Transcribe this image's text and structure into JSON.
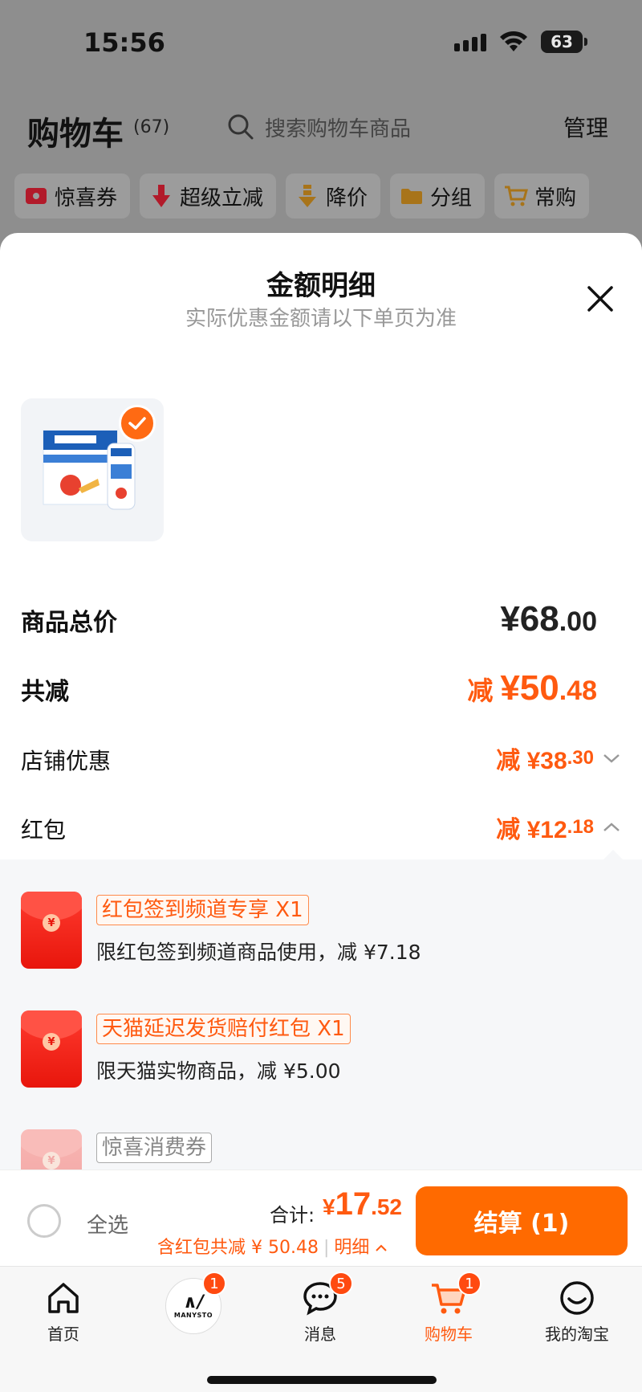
{
  "status_bar": {
    "time": "15:56",
    "battery": "63"
  },
  "cart_header": {
    "title": "购物车",
    "count": "(67)",
    "search_placeholder": "搜索购物车商品",
    "manage": "管理"
  },
  "chips": [
    {
      "label": "惊喜券",
      "icon": "coupon-icon"
    },
    {
      "label": "超级立减",
      "icon": "down-arrow-icon"
    },
    {
      "label": "降价",
      "icon": "price-drop-icon"
    },
    {
      "label": "分组",
      "icon": "folder-icon"
    },
    {
      "label": "常购",
      "icon": "cart-icon"
    }
  ],
  "sheet": {
    "title": "金额明细",
    "subtitle": "实际优惠金额请以下单页为准",
    "product": {
      "selected": true
    },
    "rows": {
      "total_label": "商品总价",
      "total_int": "¥68",
      "total_dec": ".00",
      "reduce_label": "共减",
      "reduce_prefix": "减 ",
      "reduce_int": "¥50",
      "reduce_dec": ".48",
      "shop_label": "店铺优惠",
      "shop_value_int": "减 ¥38",
      "shop_value_dec": ".30",
      "hongbao_label": "红包",
      "hongbao_value_int": "减 ¥12",
      "hongbao_value_dec": ".18"
    },
    "hongbao_items": [
      {
        "tag": "红包签到频道专享 X1",
        "desc": "限红包签到频道商品使用，减 ¥7.18",
        "faded": false
      },
      {
        "tag": "天猫延迟发货赔付红包 X1",
        "desc": "限天猫实物商品，减 ¥5.00",
        "faded": false
      },
      {
        "tag": "惊喜消费券",
        "desc": "",
        "faded": true
      }
    ]
  },
  "checkout": {
    "select_all": "全选",
    "total_label": "合计:",
    "total_prefix": "¥",
    "total_int": "17",
    "total_dec": ".52",
    "note": "含红包共减 ¥ 50.48",
    "detail": "明细",
    "button": "结算 (1)"
  },
  "tabs": [
    {
      "label": "首页",
      "icon": "home-icon",
      "badge": ""
    },
    {
      "label": "",
      "icon": "avatar-icon",
      "badge": "1",
      "avatar_text": "MANYSTO"
    },
    {
      "label": "消息",
      "icon": "message-icon",
      "badge": "5"
    },
    {
      "label": "购物车",
      "icon": "cart-icon",
      "badge": "1",
      "active": true
    },
    {
      "label": "我的淘宝",
      "icon": "profile-face-icon",
      "badge": ""
    }
  ],
  "colors": {
    "accent": "#ff5a10",
    "button": "#ff6a00"
  }
}
